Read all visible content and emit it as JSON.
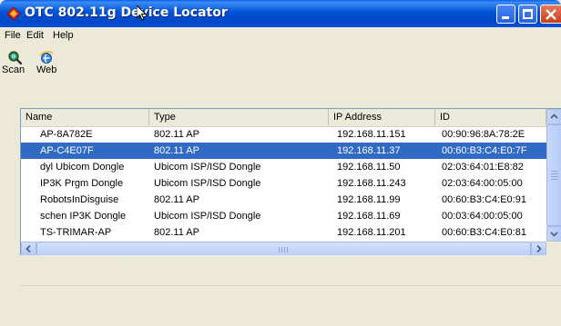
{
  "window": {
    "title": "OTC 802.11g Device Locator",
    "app_icon": "diamond-app-icon",
    "controls": [
      "minimize-icon",
      "maximize-icon",
      "close-icon"
    ]
  },
  "menu": {
    "file": "File",
    "edit": "Edit",
    "help": "Help"
  },
  "toolbar": {
    "scan_label": "Scan",
    "scan_icon": "scan-magnifier-icon",
    "web_label": "Web",
    "web_icon": "ie-globe-icon"
  },
  "table": {
    "columns": [
      "Name",
      "Type",
      "IP Address",
      "ID"
    ],
    "selected_row": 1,
    "selection_color": "#316ac5",
    "rows": [
      {
        "name": "AP-8A782E",
        "type": "802.11 AP",
        "ip": "192.168.11.151",
        "id": "00:90:96:8A:78:2E"
      },
      {
        "name": "AP-C4E07F",
        "type": "802.11 AP",
        "ip": "192.168.11.37",
        "id": "00:60:B3:C4:E0:7F"
      },
      {
        "name": "dyl Ubicom Dongle",
        "type": "Ubicom ISP/ISD Dongle",
        "ip": "192.168.11.50",
        "id": "02:03:64:01:E8:82"
      },
      {
        "name": "IP3K Prgm Dongle",
        "type": "Ubicom ISP/ISD Dongle",
        "ip": "192.168.11.243",
        "id": "02:03:64:00:05:00"
      },
      {
        "name": "RobotsInDisguise",
        "type": "802.11 AP",
        "ip": "192.168.11.99",
        "id": "00:60:B3:C4:E0:91"
      },
      {
        "name": "schen IP3K Dongle",
        "type": "Ubicom ISP/ISD Dongle",
        "ip": "192.168.11.69",
        "id": "00:03:64:00:05:00"
      },
      {
        "name": "TS-TRIMAR-AP",
        "type": "802.11 AP",
        "ip": "192.168.11.201",
        "id": "00:60:B3:C4:E0:81"
      }
    ]
  },
  "colors": {
    "titlebar": "#0052d6",
    "window_bg": "#ece9d8"
  }
}
